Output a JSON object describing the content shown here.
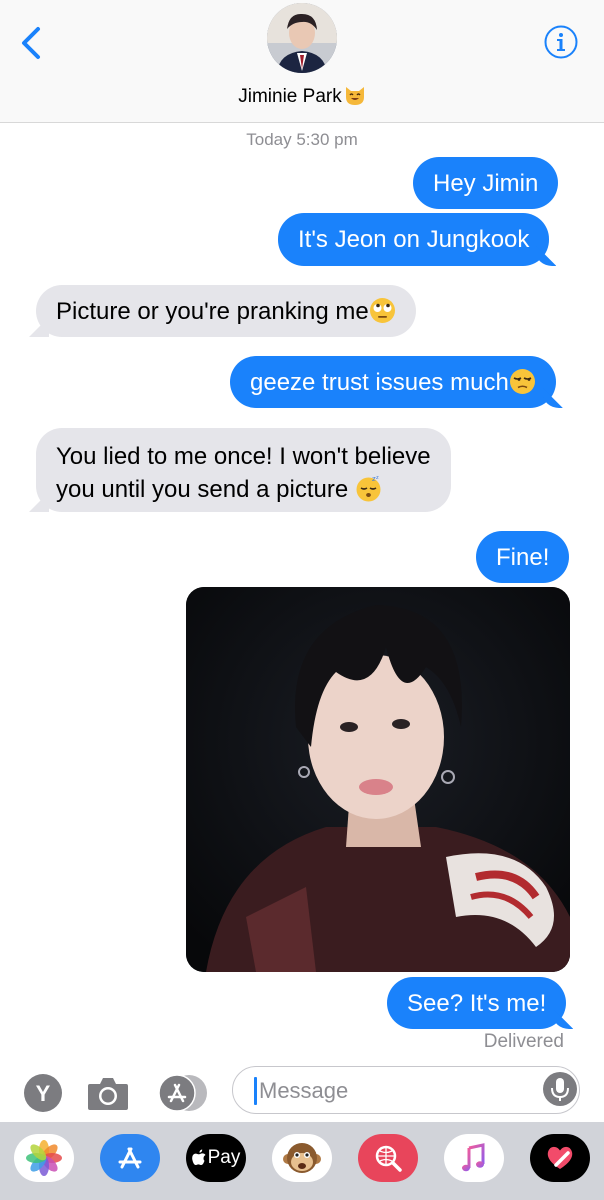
{
  "header": {
    "contact_name": "Jiminie Park",
    "contact_emoji_icon": "smiling-cat-icon",
    "back_icon": "chevron-left-icon",
    "info_icon": "info-icon"
  },
  "conversation": {
    "timestamp": "Today 5:30 pm",
    "messages": [
      {
        "from": "me",
        "text": "Hey Jimin"
      },
      {
        "from": "me",
        "text": "It's  Jeon on Jungkook"
      },
      {
        "from": "them",
        "text": "Picture or you're pranking me",
        "emoji_icon": "eye-roll-emoji"
      },
      {
        "from": "me",
        "text": "geeze trust issues much",
        "emoji_icon": "unamused-emoji"
      },
      {
        "from": "them",
        "text": "You lied to me once! I won't believe",
        "text2": "you until you send a picture",
        "emoji_icon": "sleepy-emoji"
      },
      {
        "from": "me",
        "text": "Fine!"
      },
      {
        "from": "me",
        "type": "photo",
        "photo_icon": "selfie-photo"
      },
      {
        "from": "me",
        "text": "See? It's me!"
      }
    ],
    "delivery_status": "Delivered"
  },
  "input_bar": {
    "placeholder": "Message",
    "left_icons": [
      "y-app-icon",
      "camera-icon",
      "app-store-icon"
    ],
    "mic_icon": "microphone-icon"
  },
  "app_drawer": {
    "apps": [
      "photos-app-icon",
      "app-store-icon",
      "apple-pay-icon",
      "animoji-monkey-icon",
      "web-search-icon",
      "music-icon",
      "digital-touch-icon"
    ],
    "apple_pay_label": "Pay"
  },
  "colors": {
    "outgoing_bubble": "#1a82fb",
    "incoming_bubble": "#e5e5ea",
    "accent": "#1a82fb",
    "secondary_text": "#8e8e93"
  }
}
